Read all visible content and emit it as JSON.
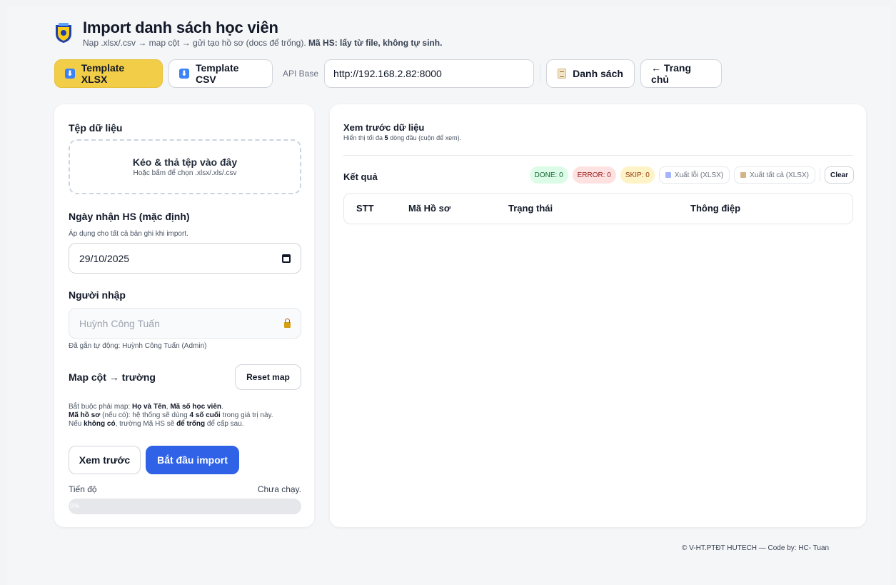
{
  "header": {
    "title": "Import danh sách học viên",
    "subtitle_plain": "Nạp .xlsx/.csv → map cột → gửi tạo hồ sơ (docs để trống).",
    "subtitle_bold": "Mã HS: lấy từ file, không tự sinh."
  },
  "toolbar": {
    "template_xlsx": "Template XLSX",
    "template_csv": "Template CSV",
    "api_label": "API Base",
    "api_value": "http://192.168.2.82:8000",
    "list_button": "Danh sách",
    "home_button": "← Trang chủ"
  },
  "left": {
    "file_label": "Tệp dữ liệu",
    "dropzone_title": "Kéo & thả tệp vào đây",
    "dropzone_sub": "Hoặc bấm để chọn .xlsx/.xls/.csv",
    "date_label": "Ngày nhận HS (mặc định)",
    "date_hint": "Áp dụng cho tất cả bản ghi khi import.",
    "date_value": "29/10/2025",
    "importer_label": "Người nhập",
    "importer_value": "Huỳnh Công Tuấn",
    "importer_hint": "Đã gắn tự động: Huỳnh Công Tuấn (Admin)",
    "map_label": "Map cột → trường",
    "reset_button": "Reset map",
    "note": {
      "l1_a": "Bắt buộc phải map: ",
      "l1_b": "Họ và Tên",
      "l1_c": ", ",
      "l1_d": "Mã số học viên",
      "l1_e": ".",
      "l2_a": "Mã hồ sơ",
      "l2_b": " (nếu có): hệ thống sẽ dùng ",
      "l2_c": "4 số cuối",
      "l2_d": " trong giá trị này.",
      "l3_a": "Nếu ",
      "l3_b": "không có",
      "l3_c": ", trường Mã HS sẽ ",
      "l3_d": "để trống",
      "l3_e": " để cấp sau."
    },
    "preview_button": "Xem trước",
    "import_button": "Bắt đầu import",
    "progress_label": "Tiến độ",
    "progress_status": "Chưa chạy.",
    "progress_text": "0%",
    "progress_value": 0
  },
  "right": {
    "preview_title": "Xem trước dữ liệu",
    "preview_sub_a": "Hiển thị tối đa ",
    "preview_sub_b": "5",
    "preview_sub_c": " dòng đầu (cuộn để xem).",
    "result_label": "Kết quả",
    "chips": {
      "done": "DONE: 0",
      "error": "ERROR: 0",
      "skip": "SKIP: 0",
      "export_errors": "Xuất lỗi (XLSX)",
      "export_all": "Xuất tất cả (XLSX)",
      "clear": "Clear"
    },
    "table_headers": [
      "STT",
      "Mã Hồ sơ",
      "Trạng thái",
      "Thông điệp"
    ]
  },
  "footer": {
    "text": "© V-HT.PTĐT HUTECH — Code by: HC- Tuan"
  },
  "colors": {
    "accent_blue": "#2f62e6",
    "yellow": "#f2cd47"
  }
}
